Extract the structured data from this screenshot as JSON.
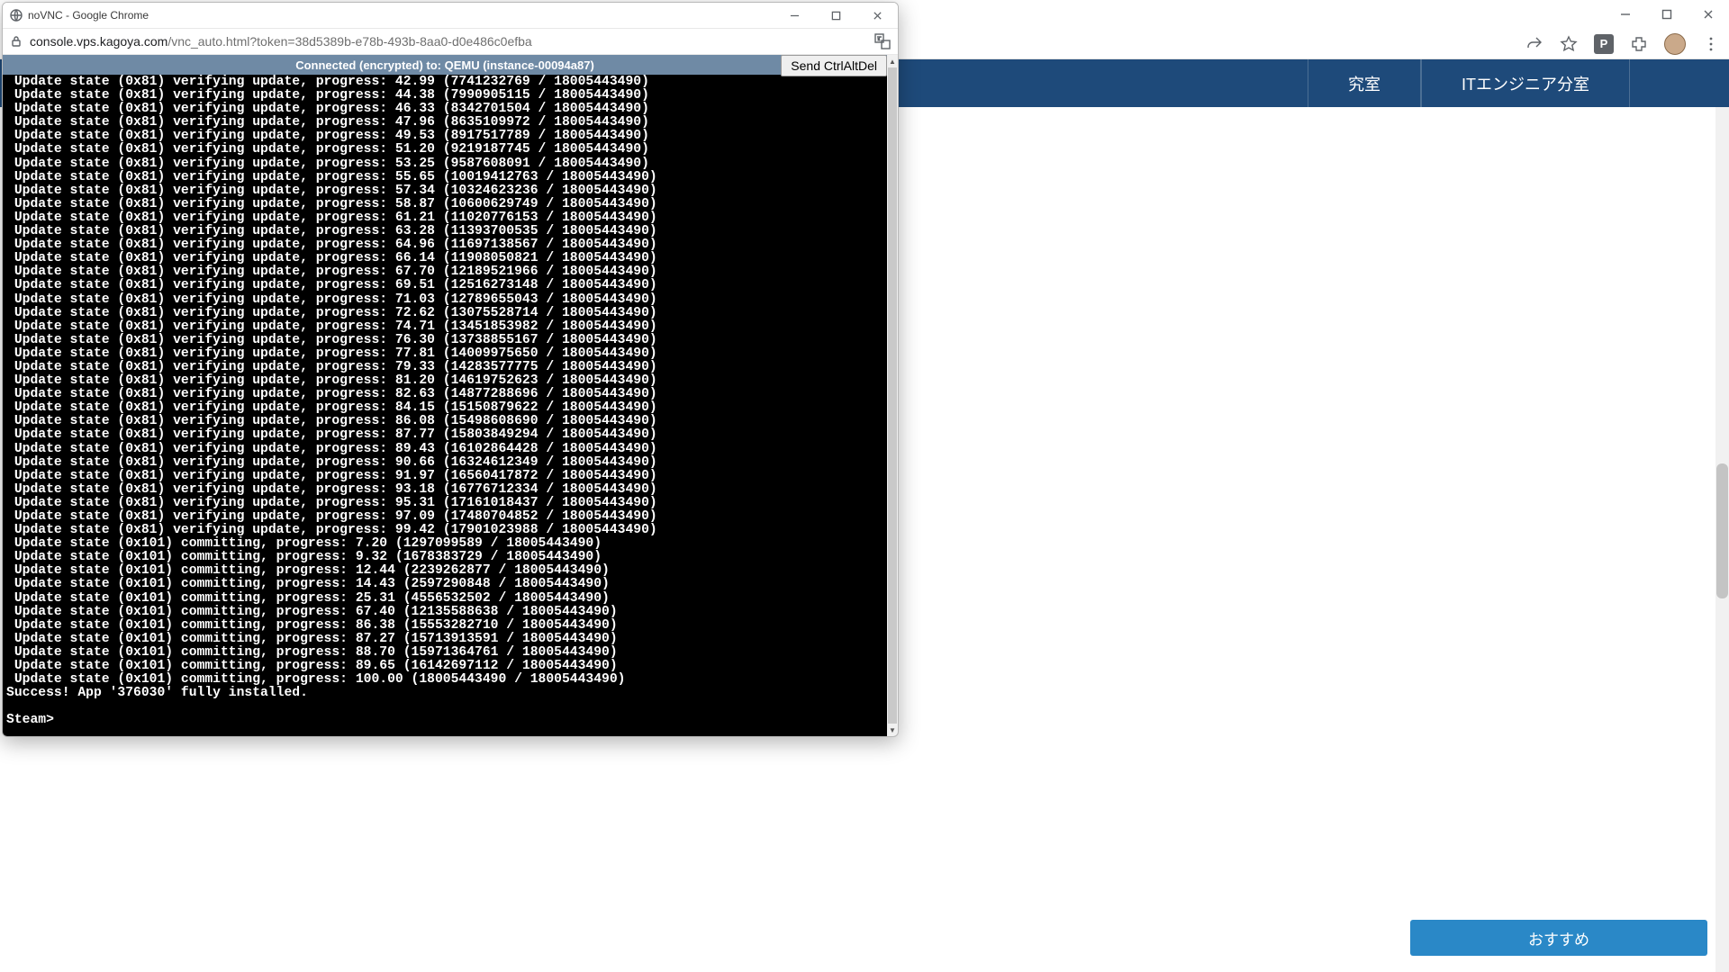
{
  "outer": {
    "min_tip": "Minimize",
    "max_tip": "Maximize",
    "close_tip": "Close",
    "new_tab_tip": "New tab",
    "toolbar": {
      "p_badge": "P"
    }
  },
  "back_nav": {
    "items": [
      "究室",
      "ITエンジニア分室"
    ]
  },
  "side_button": "おすすめ",
  "popup": {
    "title": "noVNC - Google Chrome",
    "url_host": "console.vps.kagoya.com",
    "url_path": "/vnc_auto.html?token=38d5389b-e78b-493b-8aa0-d0e486c0efba"
  },
  "vnc": {
    "status": "Connected (encrypted) to: QEMU (instance-00094a87)",
    "send_cad": "Send CtrlAltDel"
  },
  "terminal": {
    "total_bytes": "18005443490",
    "verify_lines": [
      {
        "pct": "42.99",
        "bytes": "7741232769"
      },
      {
        "pct": "44.38",
        "bytes": "7990905115"
      },
      {
        "pct": "46.33",
        "bytes": "8342701504"
      },
      {
        "pct": "47.96",
        "bytes": "8635109972"
      },
      {
        "pct": "49.53",
        "bytes": "8917517789"
      },
      {
        "pct": "51.20",
        "bytes": "9219187745"
      },
      {
        "pct": "53.25",
        "bytes": "9587608091"
      },
      {
        "pct": "55.65",
        "bytes": "10019412763"
      },
      {
        "pct": "57.34",
        "bytes": "10324623236"
      },
      {
        "pct": "58.87",
        "bytes": "10600629749"
      },
      {
        "pct": "61.21",
        "bytes": "11020776153"
      },
      {
        "pct": "63.28",
        "bytes": "11393700535"
      },
      {
        "pct": "64.96",
        "bytes": "11697138567"
      },
      {
        "pct": "66.14",
        "bytes": "11908050821"
      },
      {
        "pct": "67.70",
        "bytes": "12189521966"
      },
      {
        "pct": "69.51",
        "bytes": "12516273148"
      },
      {
        "pct": "71.03",
        "bytes": "12789655043"
      },
      {
        "pct": "72.62",
        "bytes": "13075528714"
      },
      {
        "pct": "74.71",
        "bytes": "13451853982"
      },
      {
        "pct": "76.30",
        "bytes": "13738855167"
      },
      {
        "pct": "77.81",
        "bytes": "14009975650"
      },
      {
        "pct": "79.33",
        "bytes": "14283577775"
      },
      {
        "pct": "81.20",
        "bytes": "14619752623"
      },
      {
        "pct": "82.63",
        "bytes": "14877288696"
      },
      {
        "pct": "84.15",
        "bytes": "15150879622"
      },
      {
        "pct": "86.08",
        "bytes": "15498608690"
      },
      {
        "pct": "87.77",
        "bytes": "15803849294"
      },
      {
        "pct": "89.43",
        "bytes": "16102864428"
      },
      {
        "pct": "90.66",
        "bytes": "16324612349"
      },
      {
        "pct": "91.97",
        "bytes": "16560417872"
      },
      {
        "pct": "93.18",
        "bytes": "16776712334"
      },
      {
        "pct": "95.31",
        "bytes": "17161018437"
      },
      {
        "pct": "97.09",
        "bytes": "17480704852"
      },
      {
        "pct": "99.42",
        "bytes": "17901023988"
      }
    ],
    "commit_lines": [
      {
        "pct": "7.20",
        "bytes": "1297099589"
      },
      {
        "pct": "9.32",
        "bytes": "1678383729"
      },
      {
        "pct": "12.44",
        "bytes": "2239262877"
      },
      {
        "pct": "14.43",
        "bytes": "2597290848"
      },
      {
        "pct": "25.31",
        "bytes": "4556532502"
      },
      {
        "pct": "67.40",
        "bytes": "12135588638"
      },
      {
        "pct": "86.38",
        "bytes": "15553282710"
      },
      {
        "pct": "87.27",
        "bytes": "15713913591"
      },
      {
        "pct": "88.70",
        "bytes": "15971364761"
      },
      {
        "pct": "89.65",
        "bytes": "16142697112"
      },
      {
        "pct": "100.00",
        "bytes": "18005443490"
      }
    ],
    "success_line": "Success! App '376030' fully installed.",
    "prompt": "Steam>"
  }
}
